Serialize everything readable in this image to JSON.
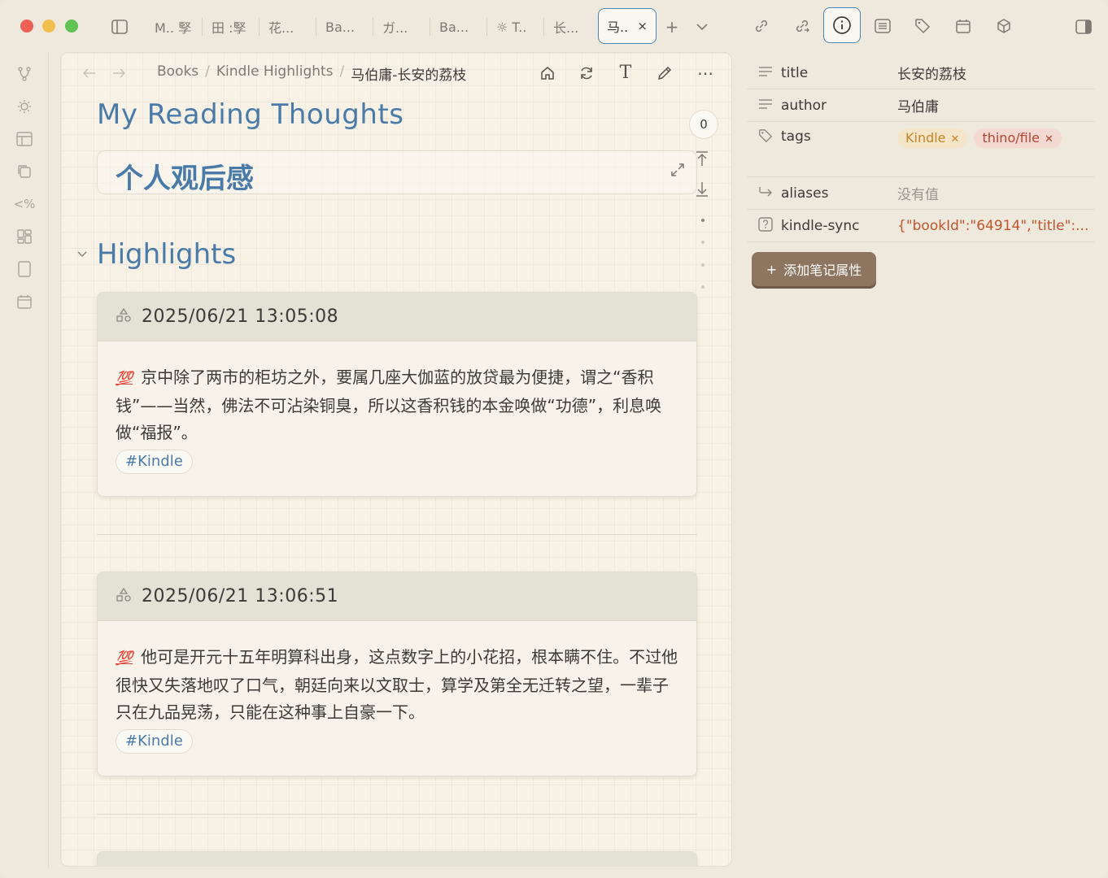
{
  "tabs": [
    {
      "label": "M.. 孯"
    },
    {
      "label": "田 :孯"
    },
    {
      "label": "花..."
    },
    {
      "label": "Ba..."
    },
    {
      "label": "ガ..."
    },
    {
      "label": "Ba..."
    },
    {
      "label": "☼ T.."
    },
    {
      "label": "长..."
    },
    {
      "label": "马..",
      "active": true
    }
  ],
  "tab_controls": {
    "close": "×",
    "new_tab": "+",
    "tab_list": "⌄"
  },
  "breadcrumb": {
    "root": "Books",
    "folder": "Kindle Highlights",
    "current": "马伯庸-长安的荔枝",
    "separator": "/"
  },
  "document": {
    "title": "My Reading Thoughts",
    "callout": "个人观后感",
    "section": "Highlights",
    "count_badge": "0",
    "highlights": [
      {
        "timestamp": "2025/06/21 13:05:08",
        "marker": "💯",
        "text": "京中除了两市的柜坊之外，要属几座大伽蓝的放贷最为便捷，谓之“香积钱”——当然，佛法不可沾染铜臭，所以这香积钱的本金唤做“功德”，利息唤做“福报”。",
        "tag": "#Kindle"
      },
      {
        "timestamp": "2025/06/21 13:06:51",
        "marker": "💯",
        "text": "他可是开元十五年明算科出身，这点数字上的小花招，根本瞒不住。不过他很快又失落地叹了口气，朝廷向来以文取士，算学及第全无迁转之望，一辈子只在九品晃荡，只能在这种事上自豪一下。",
        "tag": "#Kindle"
      }
    ]
  },
  "properties": {
    "title": {
      "key": "title",
      "value": "长安的荔枝"
    },
    "author": {
      "key": "author",
      "value": "马伯庸"
    },
    "tags": {
      "key": "tags",
      "values": [
        "Kindle",
        "thino/file"
      ]
    },
    "aliases": {
      "key": "aliases",
      "value": "没有值"
    },
    "kindle_sync": {
      "key": "kindle-sync",
      "value": "{\"bookId\":\"64914\",\"title\":..."
    },
    "add_button": "添加笔记属性"
  },
  "colors": {
    "accent": "#4a7ba8",
    "active_border": "#4a86b8",
    "tag_kindle_bg": "#f4e5c9",
    "tag_thino_bg": "#f4d8d2",
    "add_button_bg": "#8d7560",
    "marker": "#c9473a"
  }
}
